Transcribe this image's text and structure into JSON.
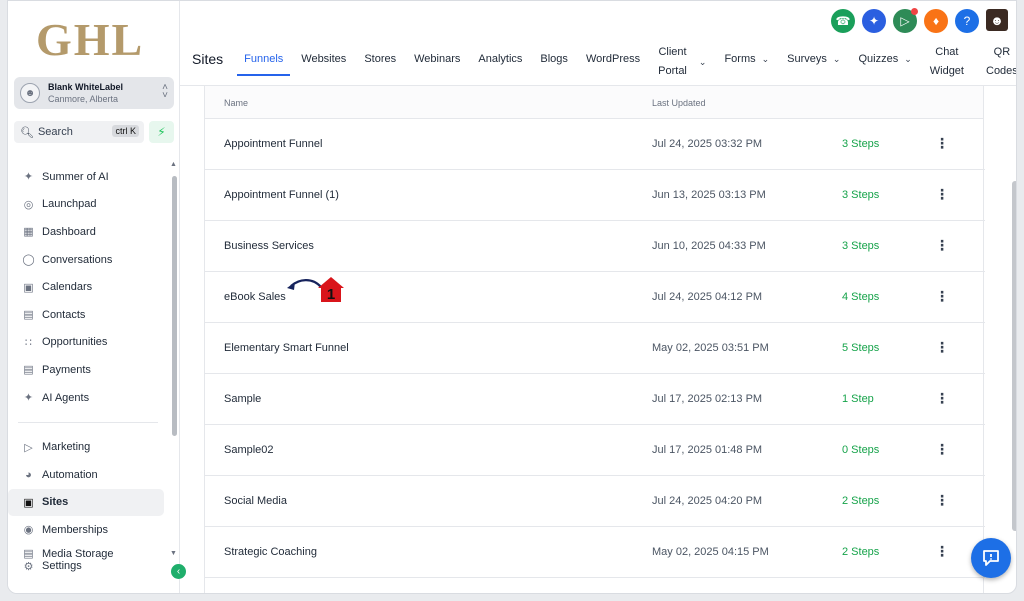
{
  "sidebar": {
    "logo": "GHL",
    "account": {
      "name": "Blank WhiteLabel",
      "location": "Canmore, Alberta"
    },
    "search": {
      "label": "Search",
      "shortcut": "ctrl K"
    },
    "nav_top": [
      {
        "label": "Summer of AI",
        "icon": "sparkle-icon"
      },
      {
        "label": "Launchpad",
        "icon": "rocket-icon"
      },
      {
        "label": "Dashboard",
        "icon": "grid-icon"
      },
      {
        "label": "Conversations",
        "icon": "chat-bubble-icon"
      },
      {
        "label": "Calendars",
        "icon": "calendar-icon"
      },
      {
        "label": "Contacts",
        "icon": "contact-card-icon"
      },
      {
        "label": "Opportunities",
        "icon": "pipeline-icon"
      },
      {
        "label": "Payments",
        "icon": "credit-card-icon"
      },
      {
        "label": "AI Agents",
        "icon": "sparkle-icon"
      }
    ],
    "nav_bottom": [
      {
        "label": "Marketing",
        "icon": "megaphone-icon"
      },
      {
        "label": "Automation",
        "icon": "automation-icon"
      },
      {
        "label": "Sites",
        "icon": "sites-icon",
        "active": true
      },
      {
        "label": "Memberships",
        "icon": "membership-icon"
      },
      {
        "label": "Media Storage",
        "icon": "media-icon"
      }
    ],
    "settings_label": "Settings"
  },
  "header": {
    "page_title": "Sites",
    "tabs": [
      {
        "label": "Funnels",
        "active": true
      },
      {
        "label": "Websites"
      },
      {
        "label": "Stores"
      },
      {
        "label": "Webinars"
      },
      {
        "label": "Analytics"
      },
      {
        "label": "Blogs"
      },
      {
        "label": "WordPress"
      }
    ],
    "client_portal": {
      "line1": "Client",
      "line2": "Portal"
    },
    "dropdown_tabs": [
      {
        "label": "Forms"
      },
      {
        "label": "Surveys"
      },
      {
        "label": "Quizzes"
      }
    ],
    "chat_widget": {
      "line1": "Chat",
      "line2": "Widget"
    },
    "qr_codes": {
      "line1": "QR",
      "line2": "Codes"
    }
  },
  "colors": {
    "phone": "#1a9f5a",
    "magic": "#2b5fe0",
    "announce": "#2e8b57",
    "notify": "#f97316",
    "help": "#1d6fe6",
    "accent": "#2563eb",
    "steps": "#16a34a"
  },
  "table": {
    "columns": {
      "name": "Name",
      "updated": "Last Updated"
    },
    "rows": [
      {
        "name": "Appointment Funnel",
        "updated": "Jul 24, 2025 03:32 PM",
        "steps": "3 Steps"
      },
      {
        "name": "Appointment Funnel (1)",
        "updated": "Jun 13, 2025 03:13 PM",
        "steps": "3 Steps"
      },
      {
        "name": "Business Services",
        "updated": "Jun 10, 2025 04:33 PM",
        "steps": "3 Steps"
      },
      {
        "name": "eBook Sales",
        "updated": "Jul 24, 2025 04:12 PM",
        "steps": "4 Steps"
      },
      {
        "name": "Elementary Smart Funnel",
        "updated": "May 02, 2025 03:51 PM",
        "steps": "5 Steps"
      },
      {
        "name": "Sample",
        "updated": "Jul 17, 2025 02:13 PM",
        "steps": "1 Step"
      },
      {
        "name": "Sample02",
        "updated": "Jul 17, 2025 01:48 PM",
        "steps": "0 Steps"
      },
      {
        "name": "Social Media",
        "updated": "Jul 24, 2025 04:20 PM",
        "steps": "2 Steps"
      },
      {
        "name": "Strategic Coaching",
        "updated": "May 02, 2025 04:15 PM",
        "steps": "2 Steps"
      }
    ]
  },
  "annotation": {
    "number": "1"
  }
}
